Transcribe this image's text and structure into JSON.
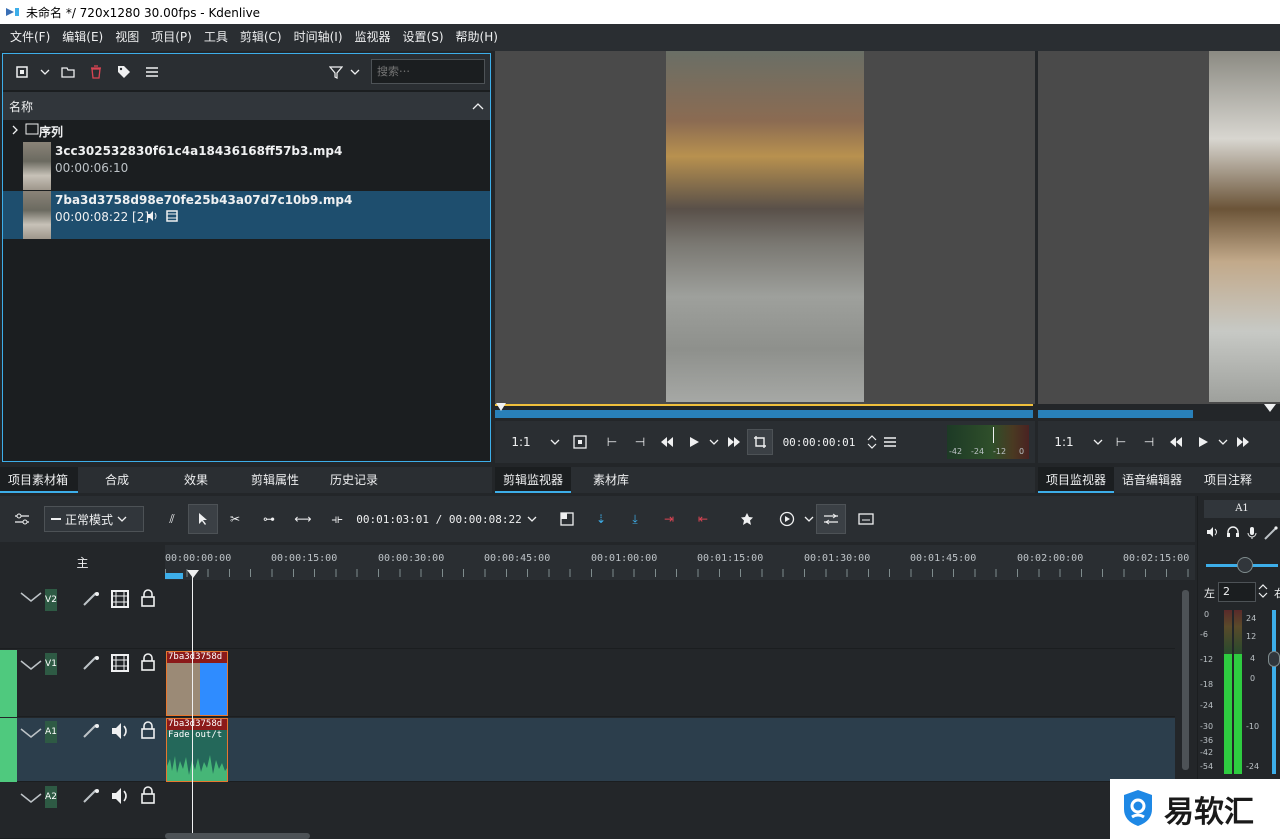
{
  "window": {
    "title": "未命名 */ 720x1280 30.00fps - Kdenlive"
  },
  "menu": [
    "文件(F)",
    "编辑(E)",
    "视图",
    "项目(P)",
    "工具",
    "剪辑(C)",
    "时间轴(I)",
    "监视器",
    "设置(S)",
    "帮助(H)"
  ],
  "bin": {
    "search_placeholder": "搜索⋯",
    "column_name": "名称",
    "folder": "序列",
    "clips": [
      {
        "name": "3cc302532830f61c4a18436168ff57b3.mp4",
        "duration": "00:00:06:10"
      },
      {
        "name": "7ba3d3758d98e70fe25b43a07d7c10b9.mp4",
        "duration": "00:00:08:22 [2]"
      }
    ]
  },
  "clip_monitor": {
    "zoom": "1:1",
    "timecode": "00:00:00:01",
    "meter": [
      "-42",
      "-24",
      "-12",
      "0"
    ]
  },
  "project_monitor": {
    "zoom": "1:1"
  },
  "left_tabs": [
    "项目素材箱",
    "合成",
    "效果",
    "剪辑属性",
    "历史记录"
  ],
  "mid_tabs": [
    "剪辑监视器",
    "素材库"
  ],
  "right_tabs": [
    "项目监视器",
    "语音编辑器",
    "项目注释"
  ],
  "timeline": {
    "mode": "正常模式",
    "position": "00:01:03:01 / 00:00:08:22",
    "master_label": "主",
    "ruler": [
      "00:00:00:00",
      "00:00:15:00",
      "00:00:30:00",
      "00:00:45:00",
      "00:01:00:00",
      "00:01:15:00",
      "00:01:30:00",
      "00:01:45:00",
      "00:02:00:00",
      "00:02:15:00"
    ],
    "tracks": [
      {
        "name": "V2",
        "type": "video"
      },
      {
        "name": "V1",
        "type": "video"
      },
      {
        "name": "A1",
        "type": "audio"
      },
      {
        "name": "A2",
        "type": "audio"
      }
    ],
    "clip_v1_label": "7ba3d3758d",
    "clip_a1_label": "7ba3d3758d",
    "clip_a1_effect": "Fade out/t"
  },
  "mixer": {
    "channel": "A1",
    "left": "左",
    "right": "右",
    "balance": "2",
    "left_scale": [
      "0",
      "-6",
      "-12",
      "-18",
      "-24",
      "-30",
      "-36",
      "-42",
      "-54"
    ],
    "right_scale": [
      "24",
      "12",
      "4",
      "0",
      "-10",
      "-24"
    ]
  },
  "watermark": {
    "text": "易软汇"
  },
  "colors": {
    "accent": "#3daee9",
    "track_green": "#4fc97e",
    "clip_border": "#e8772e",
    "selected_row": "#1e4e6e"
  }
}
